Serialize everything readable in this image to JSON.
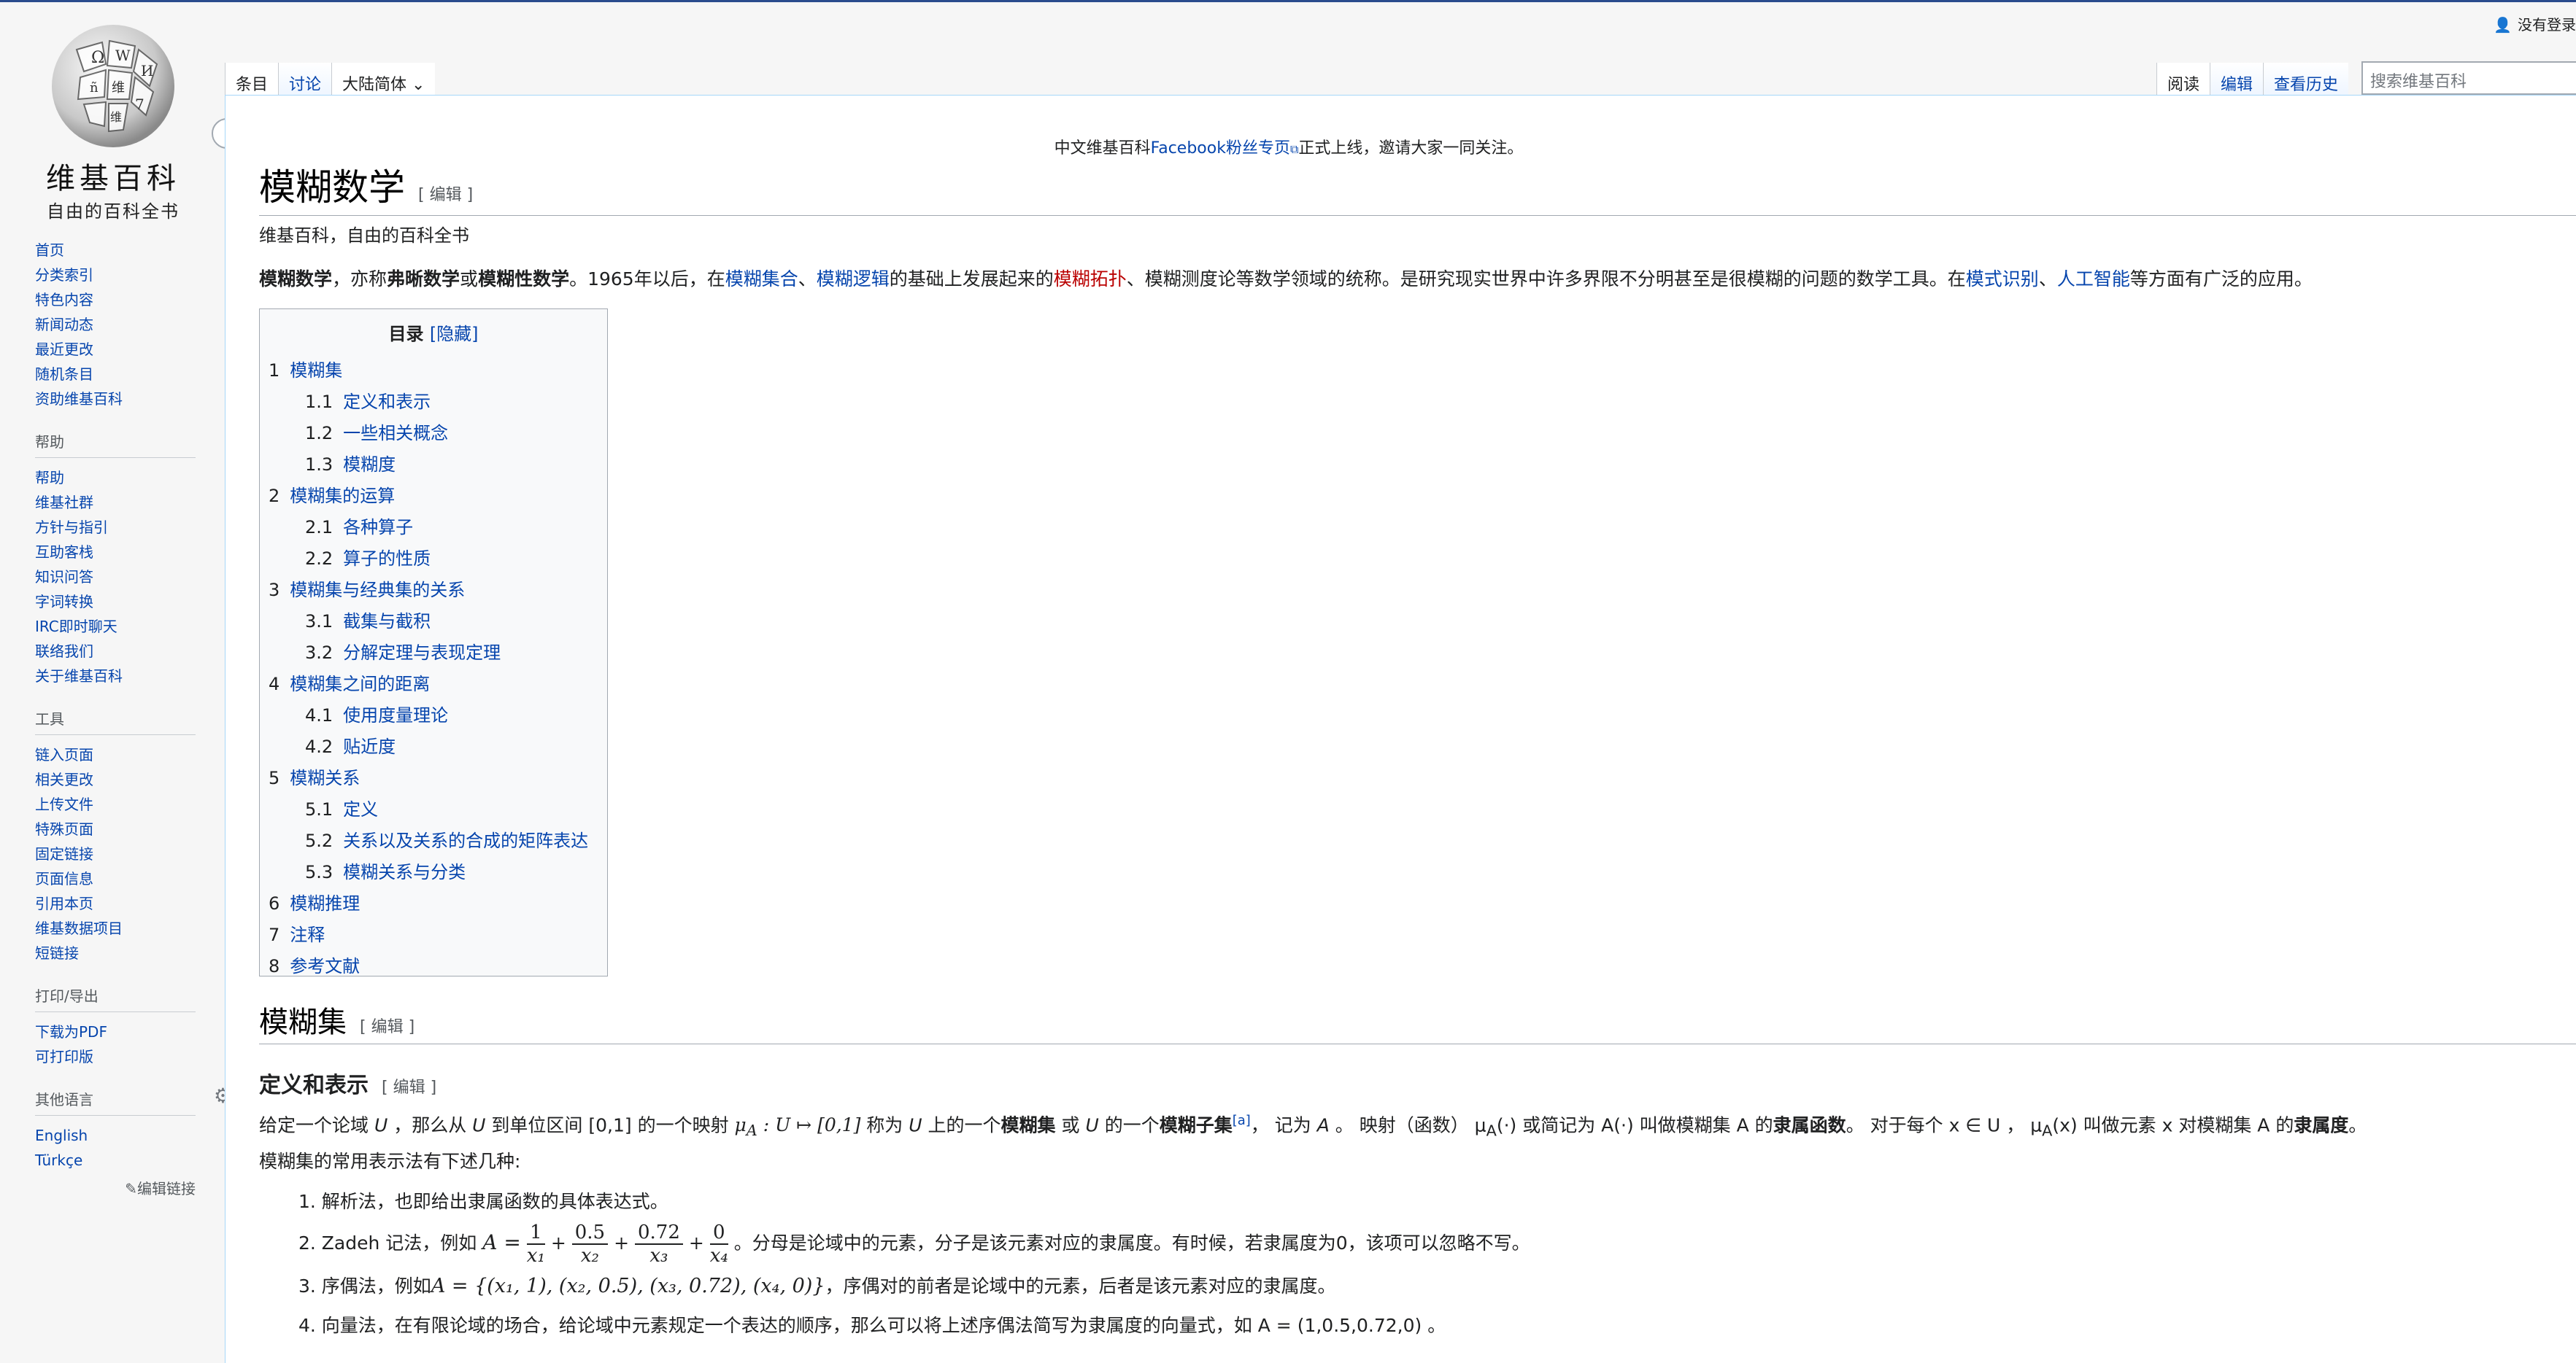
{
  "logo": {
    "title": "维基百科",
    "subtitle": "自由的百科全书"
  },
  "user": {
    "login": "没有登录"
  },
  "tabs_left": [
    "条目",
    "讨论",
    "大陆简体"
  ],
  "tabs_right": [
    "阅读",
    "编辑",
    "查看历史"
  ],
  "search": {
    "placeholder": "搜索维基百科"
  },
  "sidebar": {
    "nav": [
      "首页",
      "分类索引",
      "特色内容",
      "新闻动态",
      "最近更改",
      "随机条目",
      "资助维基百科"
    ],
    "help": {
      "head": "帮助",
      "items": [
        "帮助",
        "维基社群",
        "方针与指引",
        "互助客栈",
        "知识问答",
        "字词转换",
        "IRC即时聊天",
        "联络我们",
        "关于维基百科"
      ]
    },
    "tools": {
      "head": "工具",
      "items": [
        "链入页面",
        "相关更改",
        "上传文件",
        "特殊页面",
        "固定链接",
        "页面信息",
        "引用本页",
        "维基数据项目",
        "短链接"
      ]
    },
    "print": {
      "head": "打印/导出",
      "items": [
        "下载为PDF",
        "可打印版"
      ]
    },
    "languages": {
      "head": "其他语言",
      "items": [
        "English",
        "Türkçe"
      ],
      "edit_links": "✎编辑链接"
    }
  },
  "notice": {
    "pre": "中文维基百科",
    "link": "Facebook粉丝专页",
    "post": "正式上线，邀请大家一同关注。"
  },
  "page": {
    "title": "模糊数学",
    "edit": "[ 编辑 ]",
    "subtitle": "维基百科，自由的百科全书",
    "lead": {
      "t1": "模糊数学",
      "t2": "，亦称",
      "t3": "弗晰数学",
      "t4": "或",
      "t5": "模糊性数学",
      "t6": "。1965年以后，在",
      "l1": "模糊集合",
      "t7": "、",
      "l2": "模糊逻辑",
      "t8": "的基础上发展起来的",
      "l3": "模糊拓扑",
      "t9": "、模糊测度论等数学领域的统称。是研究现实世界中许多界限不分明甚至是很模糊的问题的数学工具。在",
      "l4": "模式识别",
      "t10": "、",
      "l5": "人工智能",
      "t11": "等方面有广泛的应用。"
    }
  },
  "toc": {
    "title": "目录",
    "hide": "[隐藏]",
    "items": [
      {
        "num": "1",
        "text": "模糊集",
        "level": 1
      },
      {
        "num": "1.1",
        "text": "定义和表示",
        "level": 2
      },
      {
        "num": "1.2",
        "text": "一些相关概念",
        "level": 2
      },
      {
        "num": "1.3",
        "text": "模糊度",
        "level": 2
      },
      {
        "num": "2",
        "text": "模糊集的运算",
        "level": 1
      },
      {
        "num": "2.1",
        "text": "各种算子",
        "level": 2
      },
      {
        "num": "2.2",
        "text": "算子的性质",
        "level": 2
      },
      {
        "num": "3",
        "text": "模糊集与经典集的关系",
        "level": 1
      },
      {
        "num": "3.1",
        "text": "截集与截积",
        "level": 2
      },
      {
        "num": "3.2",
        "text": "分解定理与表现定理",
        "level": 2
      },
      {
        "num": "4",
        "text": "模糊集之间的距离",
        "level": 1
      },
      {
        "num": "4.1",
        "text": "使用度量理论",
        "level": 2
      },
      {
        "num": "4.2",
        "text": "贴近度",
        "level": 2
      },
      {
        "num": "5",
        "text": "模糊关系",
        "level": 1
      },
      {
        "num": "5.1",
        "text": "定义",
        "level": 2
      },
      {
        "num": "5.2",
        "text": "关系以及关系的合成的矩阵表达",
        "level": 2
      },
      {
        "num": "5.3",
        "text": "模糊关系与分类",
        "level": 2
      },
      {
        "num": "6",
        "text": "模糊推理",
        "level": 1
      },
      {
        "num": "7",
        "text": "注释",
        "level": 1
      },
      {
        "num": "8",
        "text": "参考文献",
        "level": 1
      }
    ]
  },
  "section": {
    "h2": "模糊集",
    "h2_edit": "[ 编辑 ]",
    "h3": "定义和表示",
    "h3_edit": "[ 编辑 ]",
    "def": {
      "a": "给定一个论域 ",
      "U": "U",
      "b": " ，那么从 ",
      "U2": "U",
      "c": " 到单位区间 [0,1] 的一个映射 ",
      "map": "μ",
      "mapsub": "A",
      "map2": " : U ↦ [0,1]",
      "d": " 称为 ",
      "U3": "U",
      "e": " 上的一个",
      "bold1": "模糊集",
      "f": " 或 ",
      "U4": "U",
      "g": " 的一个",
      "bold2": "模糊子集",
      "note": "[a]",
      "h": "， 记为 ",
      "A": "A",
      "i": " 。 映射（函数） μ",
      "isub": "A",
      "j": "(·) 或简记为 A(·) 叫做模糊集 A 的",
      "bold3": "隶属函数",
      "k": "。 对于每个 x ∈ U ， μ",
      "ksub": "A",
      "l": "(x) 叫做元素 x 对模糊集 A 的",
      "bold4": "隶属度",
      "m": "。"
    },
    "usage": "模糊集的常用表示法有下述几种:",
    "list": {
      "i1": "1. 解析法，也即给出隶属函数的具体表达式。",
      "i2a": "2. Zadeh 记法，例如",
      "i2math_A": "A =",
      "i2fracs": [
        {
          "num": "1",
          "den": "x₁"
        },
        {
          "num": "0.5",
          "den": "x₂"
        },
        {
          "num": "0.72",
          "den": "x₃"
        },
        {
          "num": "0",
          "den": "x₄"
        }
      ],
      "i2b": "。分母是论域中的元素，分子是该元素对应的隶属度。有时候，若隶属度为0，该项可以忽略不写。",
      "i3a": "3. 序偶法，例如",
      "i3math": "A = {(x₁, 1), (x₂, 0.5), (x₃, 0.72), (x₄, 0)}",
      "i3b": "，序偶对的前者是论域中的元素，后者是该元素对应的隶属度。",
      "i4": "4. 向量法，在有限论域的场合，给论域中元素规定一个表达的顺序，那么可以将上述序偶法简写为隶属度的向量式，如 A = (1,0.5,0.72,0) 。"
    }
  }
}
